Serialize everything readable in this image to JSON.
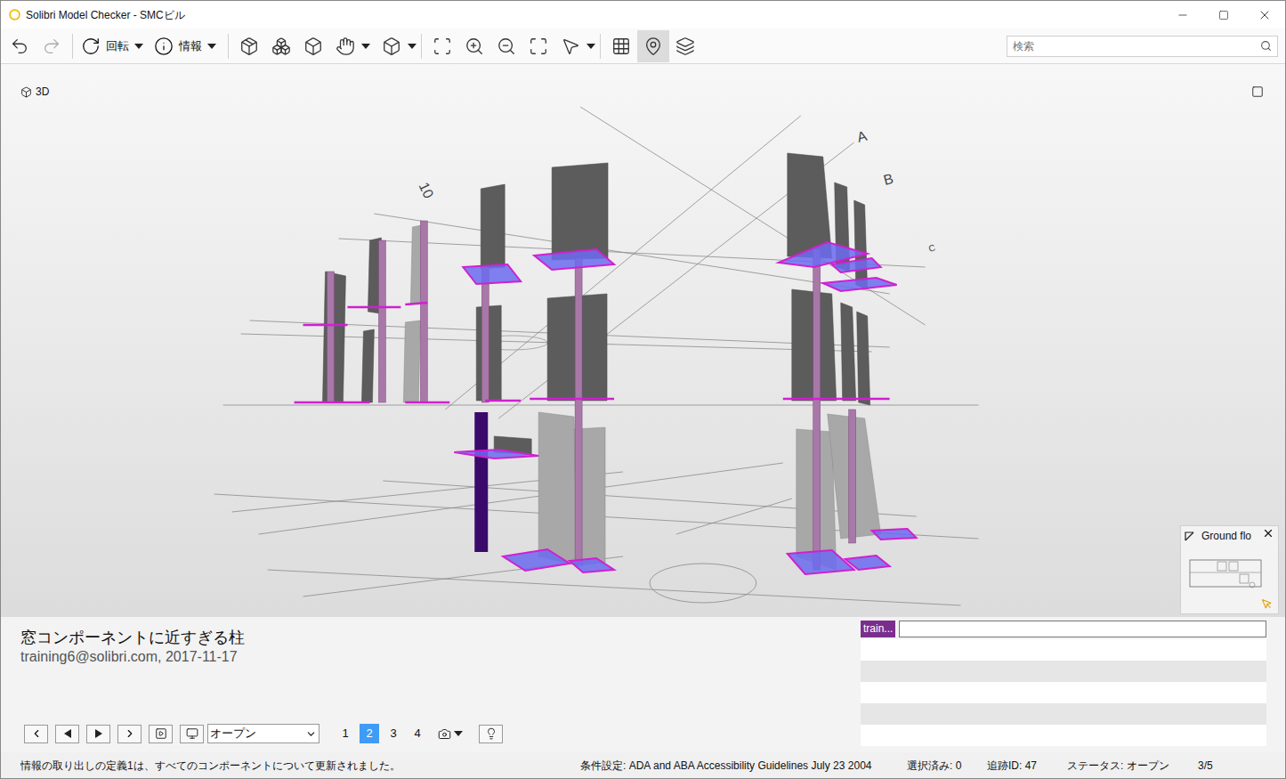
{
  "window": {
    "title": "Solibri Model Checker - SMCビル"
  },
  "toolbar": {
    "buttons": [
      {
        "label": "回転"
      },
      {
        "label": "情報"
      }
    ],
    "search": {
      "placeholder": "検索"
    }
  },
  "view": {
    "label": "3D",
    "grid_labels": [
      "10",
      "A",
      "B",
      "C"
    ]
  },
  "minimap": {
    "title": "Ground flo"
  },
  "issue": {
    "title": "窓コンポーネントに近すぎる柱",
    "author_date": "training6@solibri.com, 2017-11-17",
    "status_select": "オープン",
    "pages": [
      {
        "label": "1",
        "selected": false
      },
      {
        "label": "2",
        "selected": true
      },
      {
        "label": "3",
        "selected": false
      },
      {
        "label": "4",
        "selected": false
      }
    ]
  },
  "comments": {
    "tag": "train...",
    "input": ""
  },
  "status_bar": {
    "message": "情報の取り出しの定義1は、すべてのコンポーネントについて更新されました。",
    "condition": "条件設定: ADA and ABA Accessibility Guidelines July 23 2004",
    "selected": "選択済み: 0",
    "trace_id": "追跡ID: 47",
    "status": "ステータス: オープン",
    "count": "3/5"
  }
}
